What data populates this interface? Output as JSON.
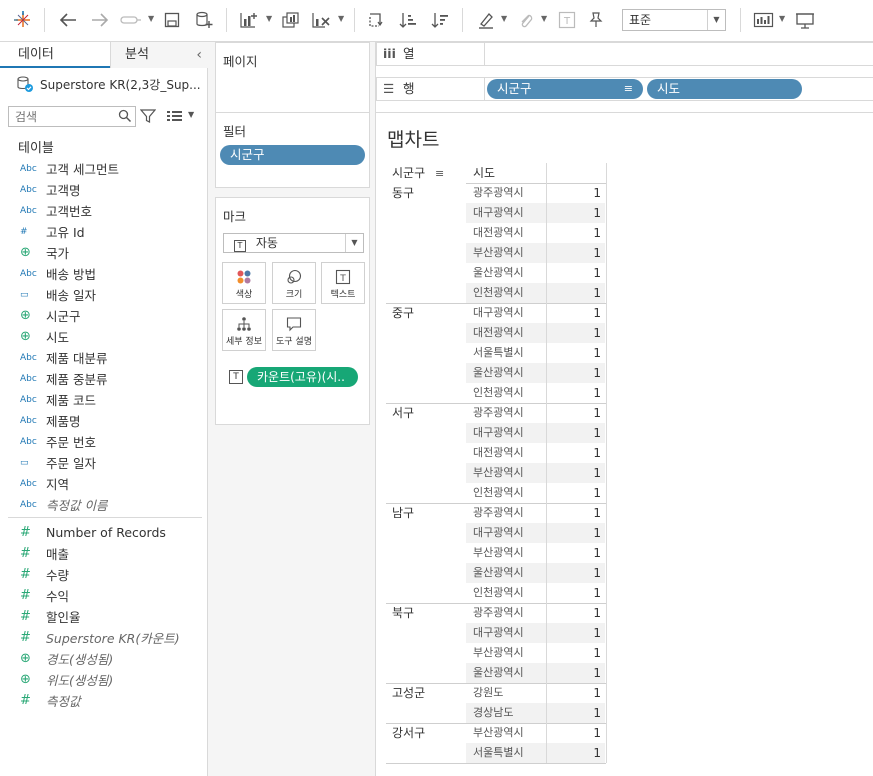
{
  "toolbar": {
    "fit": "표준"
  },
  "datapane": {
    "tabs": {
      "data": "데이터",
      "analysis": "분석"
    },
    "datasource": "Superstore KR(2,3강_Sup...",
    "search_placeholder": "검색",
    "section_title": "테이블",
    "dimensions": [
      {
        "type": "Abc",
        "label": "고객 세그먼트"
      },
      {
        "type": "Abc",
        "label": "고객명"
      },
      {
        "type": "Abc",
        "label": "고객번호"
      },
      {
        "type": "#",
        "label": "고유 Id"
      },
      {
        "type": "geo",
        "label": "국가"
      },
      {
        "type": "Abc",
        "label": "배송 방법"
      },
      {
        "type": "date",
        "label": "배송 일자"
      },
      {
        "type": "geo",
        "label": "시군구"
      },
      {
        "type": "geo",
        "label": "시도"
      },
      {
        "type": "Abc",
        "label": "제품 대분류"
      },
      {
        "type": "Abc",
        "label": "제품 중분류"
      },
      {
        "type": "Abc",
        "label": "제품 코드"
      },
      {
        "type": "Abc",
        "label": "제품명"
      },
      {
        "type": "Abc",
        "label": "주문 번호"
      },
      {
        "type": "date",
        "label": "주문 일자"
      },
      {
        "type": "Abc",
        "label": "지역"
      },
      {
        "type": "Abc",
        "label": "측정값 이름",
        "italic": true
      }
    ],
    "measures": [
      {
        "type": "#",
        "label": "Number of Records"
      },
      {
        "type": "#",
        "label": "매출"
      },
      {
        "type": "#",
        "label": "수량"
      },
      {
        "type": "#",
        "label": "수익"
      },
      {
        "type": "#",
        "label": "할인율"
      },
      {
        "type": "#",
        "label": "Superstore KR(카운트)",
        "italic": true
      },
      {
        "type": "geo",
        "label": "경도(생성됨)",
        "italic": true
      },
      {
        "type": "geo",
        "label": "위도(생성됨)",
        "italic": true
      },
      {
        "type": "#",
        "label": "측정값",
        "italic": true
      }
    ]
  },
  "shelves": {
    "pages": "페이지",
    "filters": "필터",
    "filter_pill": "시군구",
    "marks": "마크",
    "mark_type": "자동",
    "mark_buttons": [
      "색상",
      "크기",
      "텍스트",
      "세부 정보",
      "도구 설명"
    ],
    "mark_pill": "카운트(고유)(시..",
    "columns_label": "열",
    "rows_label": "행",
    "row_pills": [
      "시군구",
      "시도"
    ]
  },
  "viz": {
    "title": "맵차트",
    "col_headers": [
      "시군구",
      "시도"
    ],
    "groups": [
      {
        "gu": "동구",
        "rows": [
          [
            "광주광역시",
            1
          ],
          [
            "대구광역시",
            1
          ],
          [
            "대전광역시",
            1
          ],
          [
            "부산광역시",
            1
          ],
          [
            "울산광역시",
            1
          ],
          [
            "인천광역시",
            1
          ]
        ]
      },
      {
        "gu": "중구",
        "rows": [
          [
            "대구광역시",
            1
          ],
          [
            "대전광역시",
            1
          ],
          [
            "서울특별시",
            1
          ],
          [
            "울산광역시",
            1
          ],
          [
            "인천광역시",
            1
          ]
        ]
      },
      {
        "gu": "서구",
        "rows": [
          [
            "광주광역시",
            1
          ],
          [
            "대구광역시",
            1
          ],
          [
            "대전광역시",
            1
          ],
          [
            "부산광역시",
            1
          ],
          [
            "인천광역시",
            1
          ]
        ]
      },
      {
        "gu": "남구",
        "rows": [
          [
            "광주광역시",
            1
          ],
          [
            "대구광역시",
            1
          ],
          [
            "부산광역시",
            1
          ],
          [
            "울산광역시",
            1
          ],
          [
            "인천광역시",
            1
          ]
        ]
      },
      {
        "gu": "북구",
        "rows": [
          [
            "광주광역시",
            1
          ],
          [
            "대구광역시",
            1
          ],
          [
            "부산광역시",
            1
          ],
          [
            "울산광역시",
            1
          ]
        ]
      },
      {
        "gu": "고성군",
        "rows": [
          [
            "강원도",
            1
          ],
          [
            "경상남도",
            1
          ]
        ]
      },
      {
        "gu": "강서구",
        "rows": [
          [
            "부산광역시",
            1
          ],
          [
            "서울특별시",
            1
          ]
        ]
      }
    ]
  },
  "colors": {
    "dimension_pill": "#4e8ab4",
    "measure_pill": "#17a776",
    "dimension_icon": "#1f77b4",
    "measure_icon": "#2aa876"
  }
}
